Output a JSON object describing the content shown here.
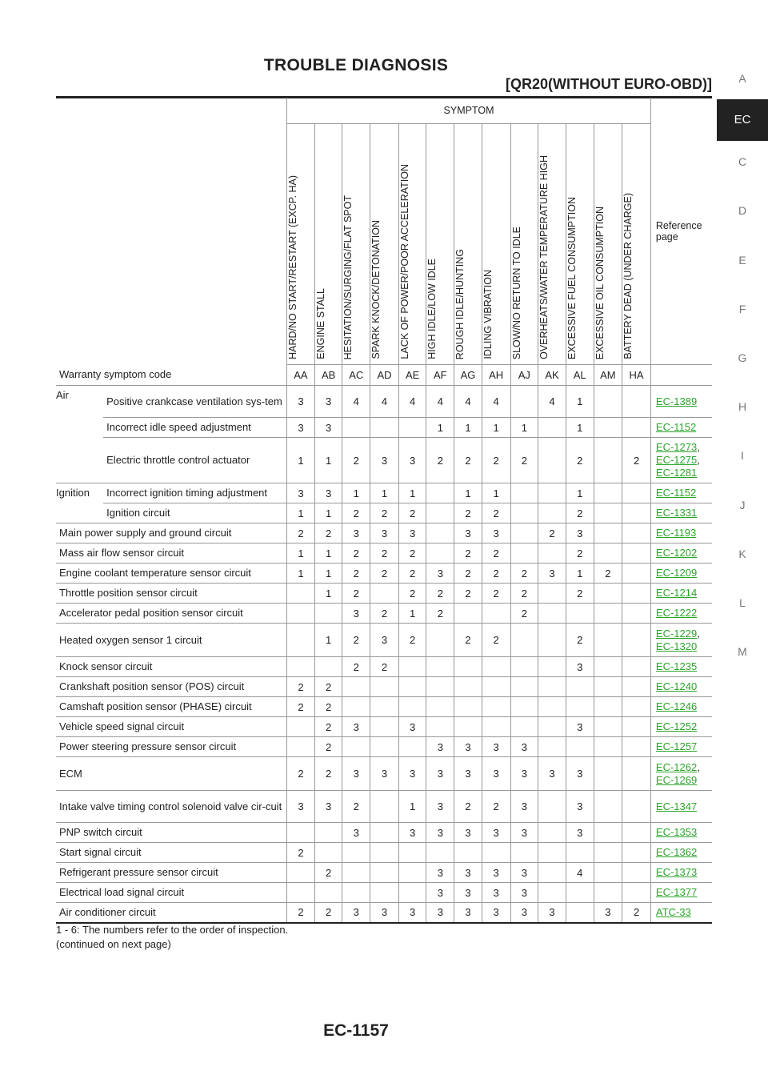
{
  "header": {
    "title": "TROUBLE DIAGNOSIS",
    "subtitle": "[QR20(WITHOUT EURO-OBD)]"
  },
  "side_nav": [
    "A",
    "EC",
    "C",
    "D",
    "E",
    "F",
    "G",
    "H",
    "I",
    "J",
    "K",
    "L",
    "M"
  ],
  "side_nav_active": "EC",
  "table": {
    "symptom_label": "SYMPTOM",
    "reference_label": "Reference page",
    "symptoms": [
      "HARD/NO START/RESTART (EXCP. HA)",
      "ENGINE STALL",
      "HESITATION/SURGING/FLAT SPOT",
      "SPARK KNOCK/DETONATION",
      "LACK OF POWER/POOR ACCELERATION",
      "HIGH IDLE/LOW IDLE",
      "ROUGH IDLE/HUNTING",
      "IDLING VIBRATION",
      "SLOW/NO RETURN TO IDLE",
      "OVERHEATS/WATER TEMPERATURE HIGH",
      "EXCESSIVE FUEL CONSUMPTION",
      "EXCESSIVE OIL CONSUMPTION",
      "BATTERY DEAD (UNDER CHARGE)"
    ],
    "warranty_label": "Warranty symptom code",
    "codes": [
      "AA",
      "AB",
      "AC",
      "AD",
      "AE",
      "AF",
      "AG",
      "AH",
      "AJ",
      "AK",
      "AL",
      "AM",
      "HA"
    ],
    "rows": [
      {
        "cat": "Air",
        "item": "Positive crankcase ventilation sys-tem",
        "v": [
          "3",
          "3",
          "4",
          "4",
          "4",
          "4",
          "4",
          "4",
          "",
          "4",
          "1",
          "",
          ""
        ],
        "ref": [
          "EC-1389"
        ],
        "h": 40
      },
      {
        "cat": "",
        "item": "Incorrect idle speed adjustment",
        "v": [
          "3",
          "3",
          "",
          "",
          "",
          "1",
          "1",
          "1",
          "1",
          "",
          "1",
          "",
          ""
        ],
        "ref": [
          "EC-1152"
        ],
        "h": 25
      },
      {
        "cat": "",
        "item": "Electric throttle control actuator",
        "v": [
          "1",
          "1",
          "2",
          "3",
          "3",
          "2",
          "2",
          "2",
          "2",
          "",
          "2",
          "",
          "2"
        ],
        "ref": [
          "EC-1273",
          "EC-1275",
          "EC-1281"
        ],
        "h": 57
      },
      {
        "cat": "Ignition",
        "item": "Incorrect ignition timing adjustment",
        "v": [
          "3",
          "3",
          "1",
          "1",
          "1",
          "",
          "1",
          "1",
          "",
          "",
          "1",
          "",
          ""
        ],
        "ref": [
          "EC-1152"
        ],
        "h": 25
      },
      {
        "cat": "",
        "item": "Ignition circuit",
        "v": [
          "1",
          "1",
          "2",
          "2",
          "2",
          "",
          "2",
          "2",
          "",
          "",
          "2",
          "",
          ""
        ],
        "ref": [
          "EC-1331"
        ],
        "h": 25
      },
      {
        "cat": "Main power supply and ground circuit",
        "item": "",
        "v": [
          "2",
          "2",
          "3",
          "3",
          "3",
          "",
          "3",
          "3",
          "",
          "2",
          "3",
          "",
          ""
        ],
        "ref": [
          "EC-1193"
        ],
        "h": 25
      },
      {
        "cat": "Mass air flow sensor circuit",
        "item": "",
        "v": [
          "1",
          "1",
          "2",
          "2",
          "2",
          "",
          "2",
          "2",
          "",
          "",
          "2",
          "",
          ""
        ],
        "ref": [
          "EC-1202"
        ],
        "h": 25
      },
      {
        "cat": "Engine coolant temperature sensor circuit",
        "item": "",
        "v": [
          "1",
          "1",
          "2",
          "2",
          "2",
          "3",
          "2",
          "2",
          "2",
          "3",
          "1",
          "2",
          ""
        ],
        "ref": [
          "EC-1209"
        ],
        "h": 25
      },
      {
        "cat": "Throttle position sensor circuit",
        "item": "",
        "v": [
          "",
          "1",
          "2",
          "",
          "2",
          "2",
          "2",
          "2",
          "2",
          "",
          "2",
          "",
          ""
        ],
        "ref": [
          "EC-1214"
        ],
        "h": 25
      },
      {
        "cat": "Accelerator pedal position sensor circuit",
        "item": "",
        "v": [
          "",
          "",
          "3",
          "2",
          "1",
          "2",
          "",
          "",
          "2",
          "",
          "",
          "",
          ""
        ],
        "ref": [
          "EC-1222"
        ],
        "h": 25
      },
      {
        "cat": "Heated oxygen sensor 1 circuit",
        "item": "",
        "v": [
          "",
          "1",
          "2",
          "3",
          "2",
          "",
          "2",
          "2",
          "",
          "",
          "2",
          "",
          ""
        ],
        "ref": [
          "EC-1229",
          "EC-1320"
        ],
        "h": 42
      },
      {
        "cat": "Knock sensor circuit",
        "item": "",
        "v": [
          "",
          "",
          "2",
          "2",
          "",
          "",
          "",
          "",
          "",
          "",
          "3",
          "",
          ""
        ],
        "ref": [
          "EC-1235"
        ],
        "h": 25
      },
      {
        "cat": "Crankshaft position sensor (POS) circuit",
        "item": "",
        "v": [
          "2",
          "2",
          "",
          "",
          "",
          "",
          "",
          "",
          "",
          "",
          "",
          "",
          ""
        ],
        "ref": [
          "EC-1240"
        ],
        "h": 25
      },
      {
        "cat": "Camshaft position sensor (PHASE) circuit",
        "item": "",
        "v": [
          "2",
          "2",
          "",
          "",
          "",
          "",
          "",
          "",
          "",
          "",
          "",
          "",
          ""
        ],
        "ref": [
          "EC-1246"
        ],
        "h": 25
      },
      {
        "cat": "Vehicle speed signal circuit",
        "item": "",
        "v": [
          "",
          "2",
          "3",
          "",
          "3",
          "",
          "",
          "",
          "",
          "",
          "3",
          "",
          ""
        ],
        "ref": [
          "EC-1252"
        ],
        "h": 25
      },
      {
        "cat": "Power steering pressure sensor circuit",
        "item": "",
        "v": [
          "",
          "2",
          "",
          "",
          "",
          "3",
          "3",
          "3",
          "3",
          "",
          "",
          "",
          ""
        ],
        "ref": [
          "EC-1257"
        ],
        "h": 25
      },
      {
        "cat": "ECM",
        "item": "",
        "v": [
          "2",
          "2",
          "3",
          "3",
          "3",
          "3",
          "3",
          "3",
          "3",
          "3",
          "3",
          "",
          ""
        ],
        "ref": [
          "EC-1262",
          "EC-1269"
        ],
        "h": 42
      },
      {
        "cat": "Intake valve timing control solenoid valve cir-cuit",
        "item": "",
        "v": [
          "3",
          "3",
          "2",
          "",
          "1",
          "3",
          "2",
          "2",
          "3",
          "",
          "3",
          "",
          ""
        ],
        "ref": [
          "EC-1347"
        ],
        "h": 40
      },
      {
        "cat": "PNP switch circuit",
        "item": "",
        "v": [
          "",
          "",
          "3",
          "",
          "3",
          "3",
          "3",
          "3",
          "3",
          "",
          "3",
          "",
          ""
        ],
        "ref": [
          "EC-1353"
        ],
        "h": 25
      },
      {
        "cat": "Start signal circuit",
        "item": "",
        "v": [
          "2",
          "",
          "",
          "",
          "",
          "",
          "",
          "",
          "",
          "",
          "",
          "",
          ""
        ],
        "ref": [
          "EC-1362"
        ],
        "h": 25
      },
      {
        "cat": "Refrigerant pressure sensor circuit",
        "item": "",
        "v": [
          "",
          "2",
          "",
          "",
          "",
          "3",
          "3",
          "3",
          "3",
          "",
          "4",
          "",
          ""
        ],
        "ref": [
          "EC-1373"
        ],
        "h": 25
      },
      {
        "cat": "Electrical load signal circuit",
        "item": "",
        "v": [
          "",
          "",
          "",
          "",
          "",
          "3",
          "3",
          "3",
          "3",
          "",
          "",
          "",
          ""
        ],
        "ref": [
          "EC-1377"
        ],
        "h": 25
      },
      {
        "cat": "Air conditioner circuit",
        "item": "",
        "v": [
          "2",
          "2",
          "3",
          "3",
          "3",
          "3",
          "3",
          "3",
          "3",
          "3",
          "",
          "3",
          "2"
        ],
        "ref": [
          "ATC-33"
        ],
        "h": 25
      }
    ]
  },
  "footnotes": [
    "1 - 6: The numbers refer to the order of inspection.",
    "(continued on next page)"
  ],
  "page_number": "EC-1157"
}
